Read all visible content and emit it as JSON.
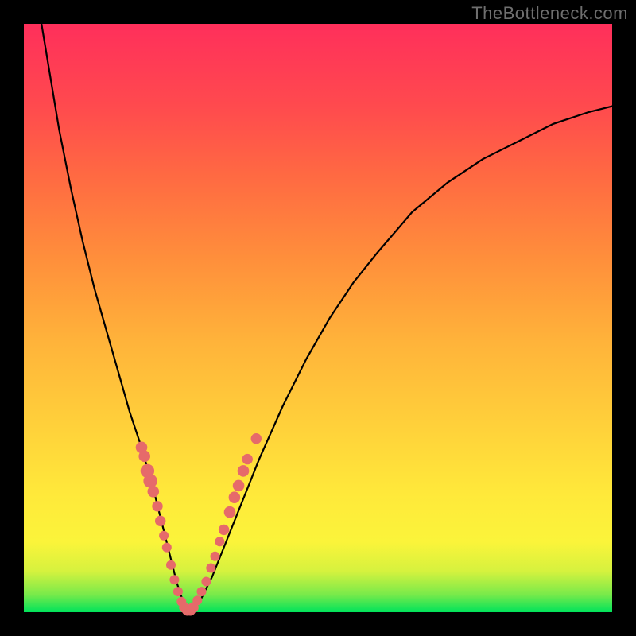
{
  "watermark": "TheBottleneck.com",
  "chart_data": {
    "type": "line",
    "title": "",
    "xlabel": "",
    "ylabel": "",
    "xlim": [
      0,
      100
    ],
    "ylim": [
      0,
      100
    ],
    "series": [
      {
        "name": "bottleneck-curve",
        "x": [
          3,
          4,
          5,
          6,
          8,
          10,
          12,
          14,
          16,
          18,
          20,
          22,
          23,
          24,
          25,
          26,
          27,
          28,
          30,
          32,
          34,
          36,
          38,
          40,
          44,
          48,
          52,
          56,
          60,
          66,
          72,
          78,
          84,
          90,
          96,
          100
        ],
        "y": [
          100,
          94,
          88,
          82,
          72,
          63,
          55,
          48,
          41,
          34,
          28,
          21,
          17,
          13,
          9,
          5,
          2,
          0,
          2,
          6,
          11,
          16,
          21,
          26,
          35,
          43,
          50,
          56,
          61,
          68,
          73,
          77,
          80,
          83,
          85,
          86
        ]
      }
    ],
    "markers": {
      "name": "highlight-points",
      "color": "#e66a6a",
      "points": [
        {
          "x": 20.0,
          "y": 28.0,
          "r": 1.1
        },
        {
          "x": 20.5,
          "y": 26.5,
          "r": 1.1
        },
        {
          "x": 21.0,
          "y": 24.0,
          "r": 1.3
        },
        {
          "x": 21.5,
          "y": 22.3,
          "r": 1.3
        },
        {
          "x": 22.0,
          "y": 20.5,
          "r": 1.1
        },
        {
          "x": 22.7,
          "y": 18.0,
          "r": 1.0
        },
        {
          "x": 23.2,
          "y": 15.5,
          "r": 1.0
        },
        {
          "x": 23.8,
          "y": 13.0,
          "r": 0.9
        },
        {
          "x": 24.3,
          "y": 11.0,
          "r": 0.9
        },
        {
          "x": 25.0,
          "y": 8.0,
          "r": 0.9
        },
        {
          "x": 25.6,
          "y": 5.5,
          "r": 0.9
        },
        {
          "x": 26.2,
          "y": 3.5,
          "r": 0.9
        },
        {
          "x": 26.8,
          "y": 1.8,
          "r": 0.9
        },
        {
          "x": 27.3,
          "y": 0.8,
          "r": 1.0
        },
        {
          "x": 27.8,
          "y": 0.3,
          "r": 1.0
        },
        {
          "x": 28.3,
          "y": 0.3,
          "r": 1.0
        },
        {
          "x": 28.8,
          "y": 0.8,
          "r": 1.0
        },
        {
          "x": 29.5,
          "y": 2.0,
          "r": 0.9
        },
        {
          "x": 30.2,
          "y": 3.5,
          "r": 0.9
        },
        {
          "x": 31.0,
          "y": 5.2,
          "r": 0.9
        },
        {
          "x": 31.8,
          "y": 7.5,
          "r": 0.9
        },
        {
          "x": 32.5,
          "y": 9.5,
          "r": 0.9
        },
        {
          "x": 33.3,
          "y": 12.0,
          "r": 0.9
        },
        {
          "x": 34.0,
          "y": 14.0,
          "r": 1.0
        },
        {
          "x": 35.0,
          "y": 17.0,
          "r": 1.1
        },
        {
          "x": 35.8,
          "y": 19.5,
          "r": 1.1
        },
        {
          "x": 36.5,
          "y": 21.5,
          "r": 1.1
        },
        {
          "x": 37.3,
          "y": 24.0,
          "r": 1.1
        },
        {
          "x": 38.0,
          "y": 26.0,
          "r": 1.0
        },
        {
          "x": 39.5,
          "y": 29.5,
          "r": 1.0
        }
      ]
    }
  }
}
